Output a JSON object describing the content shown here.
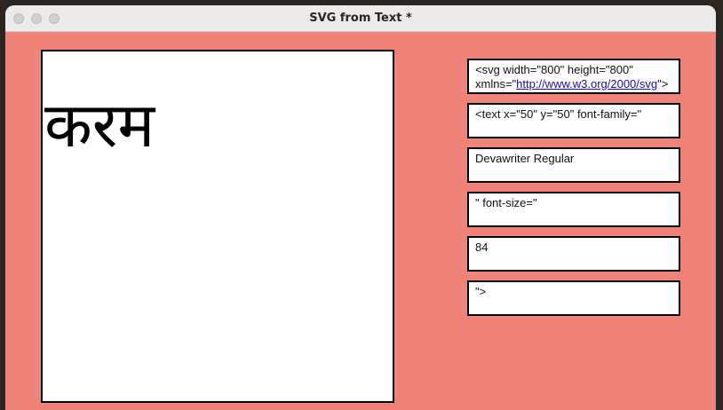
{
  "window": {
    "title": "SVG from Text *"
  },
  "preview": {
    "text": "करम"
  },
  "fields": {
    "svg_open_prefix": "<svg width=\"800\" height=\"800\" xmlns=\"",
    "svg_namespace_link": "http://www.w3.org/2000/svg",
    "svg_open_suffix": "\">",
    "text_open": "<text x=\"50\" y=\"50\" font-family=\"",
    "font_family_value": "Devawriter Regular",
    "font_size_attr": "\" font-size=\"",
    "font_size_value": "84",
    "text_close": "\">"
  },
  "colors": {
    "background": "#f08379",
    "titlebar": "#ebebeb"
  }
}
